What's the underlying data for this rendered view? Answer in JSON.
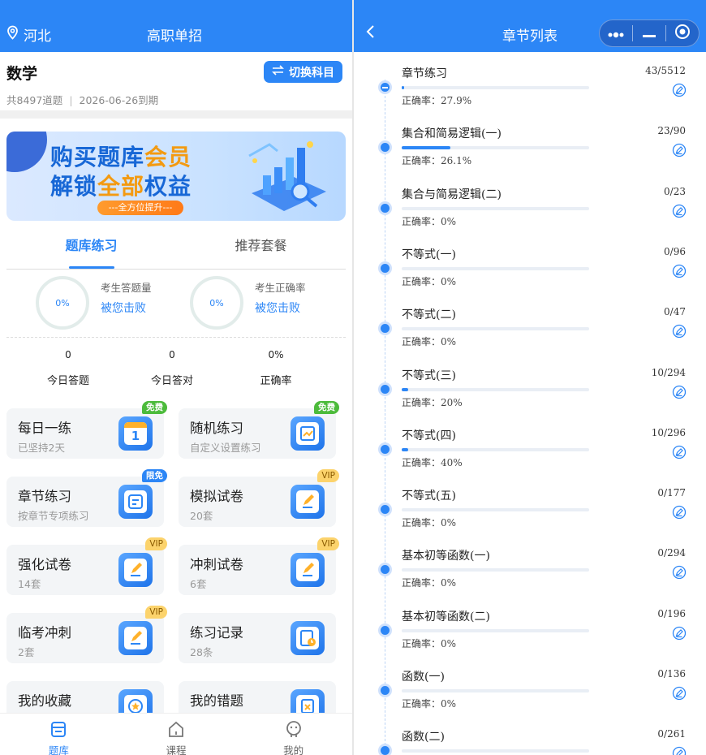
{
  "left": {
    "location": "河北",
    "title": "高职单招",
    "subject": {
      "name": "数学",
      "question_count": "共8497道题",
      "expiry": "2026-06-26到期",
      "switch_label": "切换科目"
    },
    "banner": {
      "line1_a": "购买",
      "line1_b": "题库",
      "line1_c": "会员",
      "line2_a": "解锁",
      "line2_b": "全部",
      "line2_c": "权益",
      "pill": "---全方位提升---"
    },
    "tabs": [
      "题库练习",
      "推荐套餐"
    ],
    "stats": [
      {
        "ring": "0%",
        "caption": "考生答题量",
        "value": "被您击败"
      },
      {
        "ring": "0%",
        "caption": "考生正确率",
        "value": "被您击败"
      }
    ],
    "today": [
      {
        "value": "0",
        "caption": "今日答题"
      },
      {
        "value": "0",
        "caption": "今日答对"
      },
      {
        "value": "0%",
        "caption": "正确率"
      }
    ],
    "cards": [
      {
        "title": "每日一练",
        "sub": "已坚持2天",
        "badge": "免费",
        "icon": "calendar-icon",
        "icon_text": "1"
      },
      {
        "title": "随机练习",
        "sub": "自定义设置练习",
        "badge": "免费",
        "icon": "shuffle-note-icon"
      },
      {
        "title": "章节练习",
        "sub": "按章节专项练习",
        "badge": "限免",
        "icon": "book-icon"
      },
      {
        "title": "模拟试卷",
        "sub": "20套",
        "badge": "VIP",
        "icon": "exam-pen-icon"
      },
      {
        "title": "强化试卷",
        "sub": "14套",
        "badge": "VIP",
        "icon": "exam-pen-icon"
      },
      {
        "title": "冲刺试卷",
        "sub": "6套",
        "badge": "VIP",
        "icon": "exam-pen-icon"
      },
      {
        "title": "临考冲刺",
        "sub": "2套",
        "badge": "VIP",
        "icon": "exam-pen-icon"
      },
      {
        "title": "练习记录",
        "sub": "28条",
        "badge": "",
        "icon": "record-clock-icon"
      },
      {
        "title": "我的收藏",
        "sub": "",
        "badge": "",
        "icon": "star-icon"
      },
      {
        "title": "我的错题",
        "sub": "",
        "badge": "",
        "icon": "wrong-icon"
      }
    ],
    "nav": [
      {
        "label": "题库",
        "icon": "question-bank-icon",
        "active": true
      },
      {
        "label": "课程",
        "icon": "course-icon",
        "active": false
      },
      {
        "label": "我的",
        "icon": "profile-icon",
        "active": false
      }
    ]
  },
  "right": {
    "title": "章节列表",
    "chapters": [
      {
        "name": "章节练习",
        "count": "43/5512",
        "rate": "正确率：27.9%",
        "progress": 0.01,
        "expanded": true
      },
      {
        "name": "集合和简易逻辑(一)",
        "count": "23/90",
        "rate": "正确率：26.1%",
        "progress": 0.26
      },
      {
        "name": "集合与简易逻辑(二)",
        "count": "0/23",
        "rate": "正确率：0%",
        "progress": 0
      },
      {
        "name": "不等式(一)",
        "count": "0/96",
        "rate": "正确率：0%",
        "progress": 0
      },
      {
        "name": "不等式(二)",
        "count": "0/47",
        "rate": "正确率：0%",
        "progress": 0
      },
      {
        "name": "不等式(三)",
        "count": "10/294",
        "rate": "正确率：20%",
        "progress": 0.034
      },
      {
        "name": "不等式(四)",
        "count": "10/296",
        "rate": "正确率：40%",
        "progress": 0.034
      },
      {
        "name": "不等式(五)",
        "count": "0/177",
        "rate": "正确率：0%",
        "progress": 0
      },
      {
        "name": "基本初等函数(一)",
        "count": "0/294",
        "rate": "正确率：0%",
        "progress": 0
      },
      {
        "name": "基本初等函数(二)",
        "count": "0/196",
        "rate": "正确率：0%",
        "progress": 0
      },
      {
        "name": "函数(一)",
        "count": "0/136",
        "rate": "正确率：0%",
        "progress": 0
      },
      {
        "name": "函数(二)",
        "count": "0/261",
        "rate": "",
        "progress": 0
      }
    ]
  },
  "colors": {
    "primary": "#2c86f6",
    "free": "#4cbb3b",
    "vip": "#fcd36c",
    "orange": "#f39a11"
  }
}
